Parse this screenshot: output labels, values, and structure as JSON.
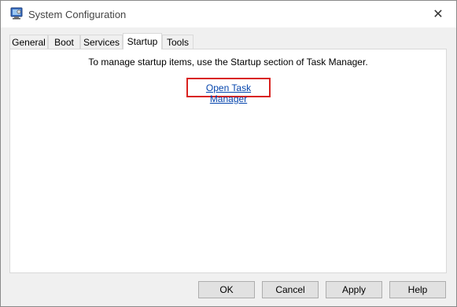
{
  "window": {
    "title": "System Configuration",
    "app_icon": "msconfig-icon",
    "close_glyph": "✕"
  },
  "tabs": [
    {
      "label": "General",
      "active": false
    },
    {
      "label": "Boot",
      "active": false
    },
    {
      "label": "Services",
      "active": false
    },
    {
      "label": "Startup",
      "active": true
    },
    {
      "label": "Tools",
      "active": false
    }
  ],
  "startup_panel": {
    "message": "To manage startup items, use the Startup section of Task Manager.",
    "link_label": "Open Task Manager",
    "highlight_color": "#d9221f"
  },
  "buttons": {
    "ok": "OK",
    "cancel": "Cancel",
    "apply": "Apply",
    "help": "Help"
  }
}
